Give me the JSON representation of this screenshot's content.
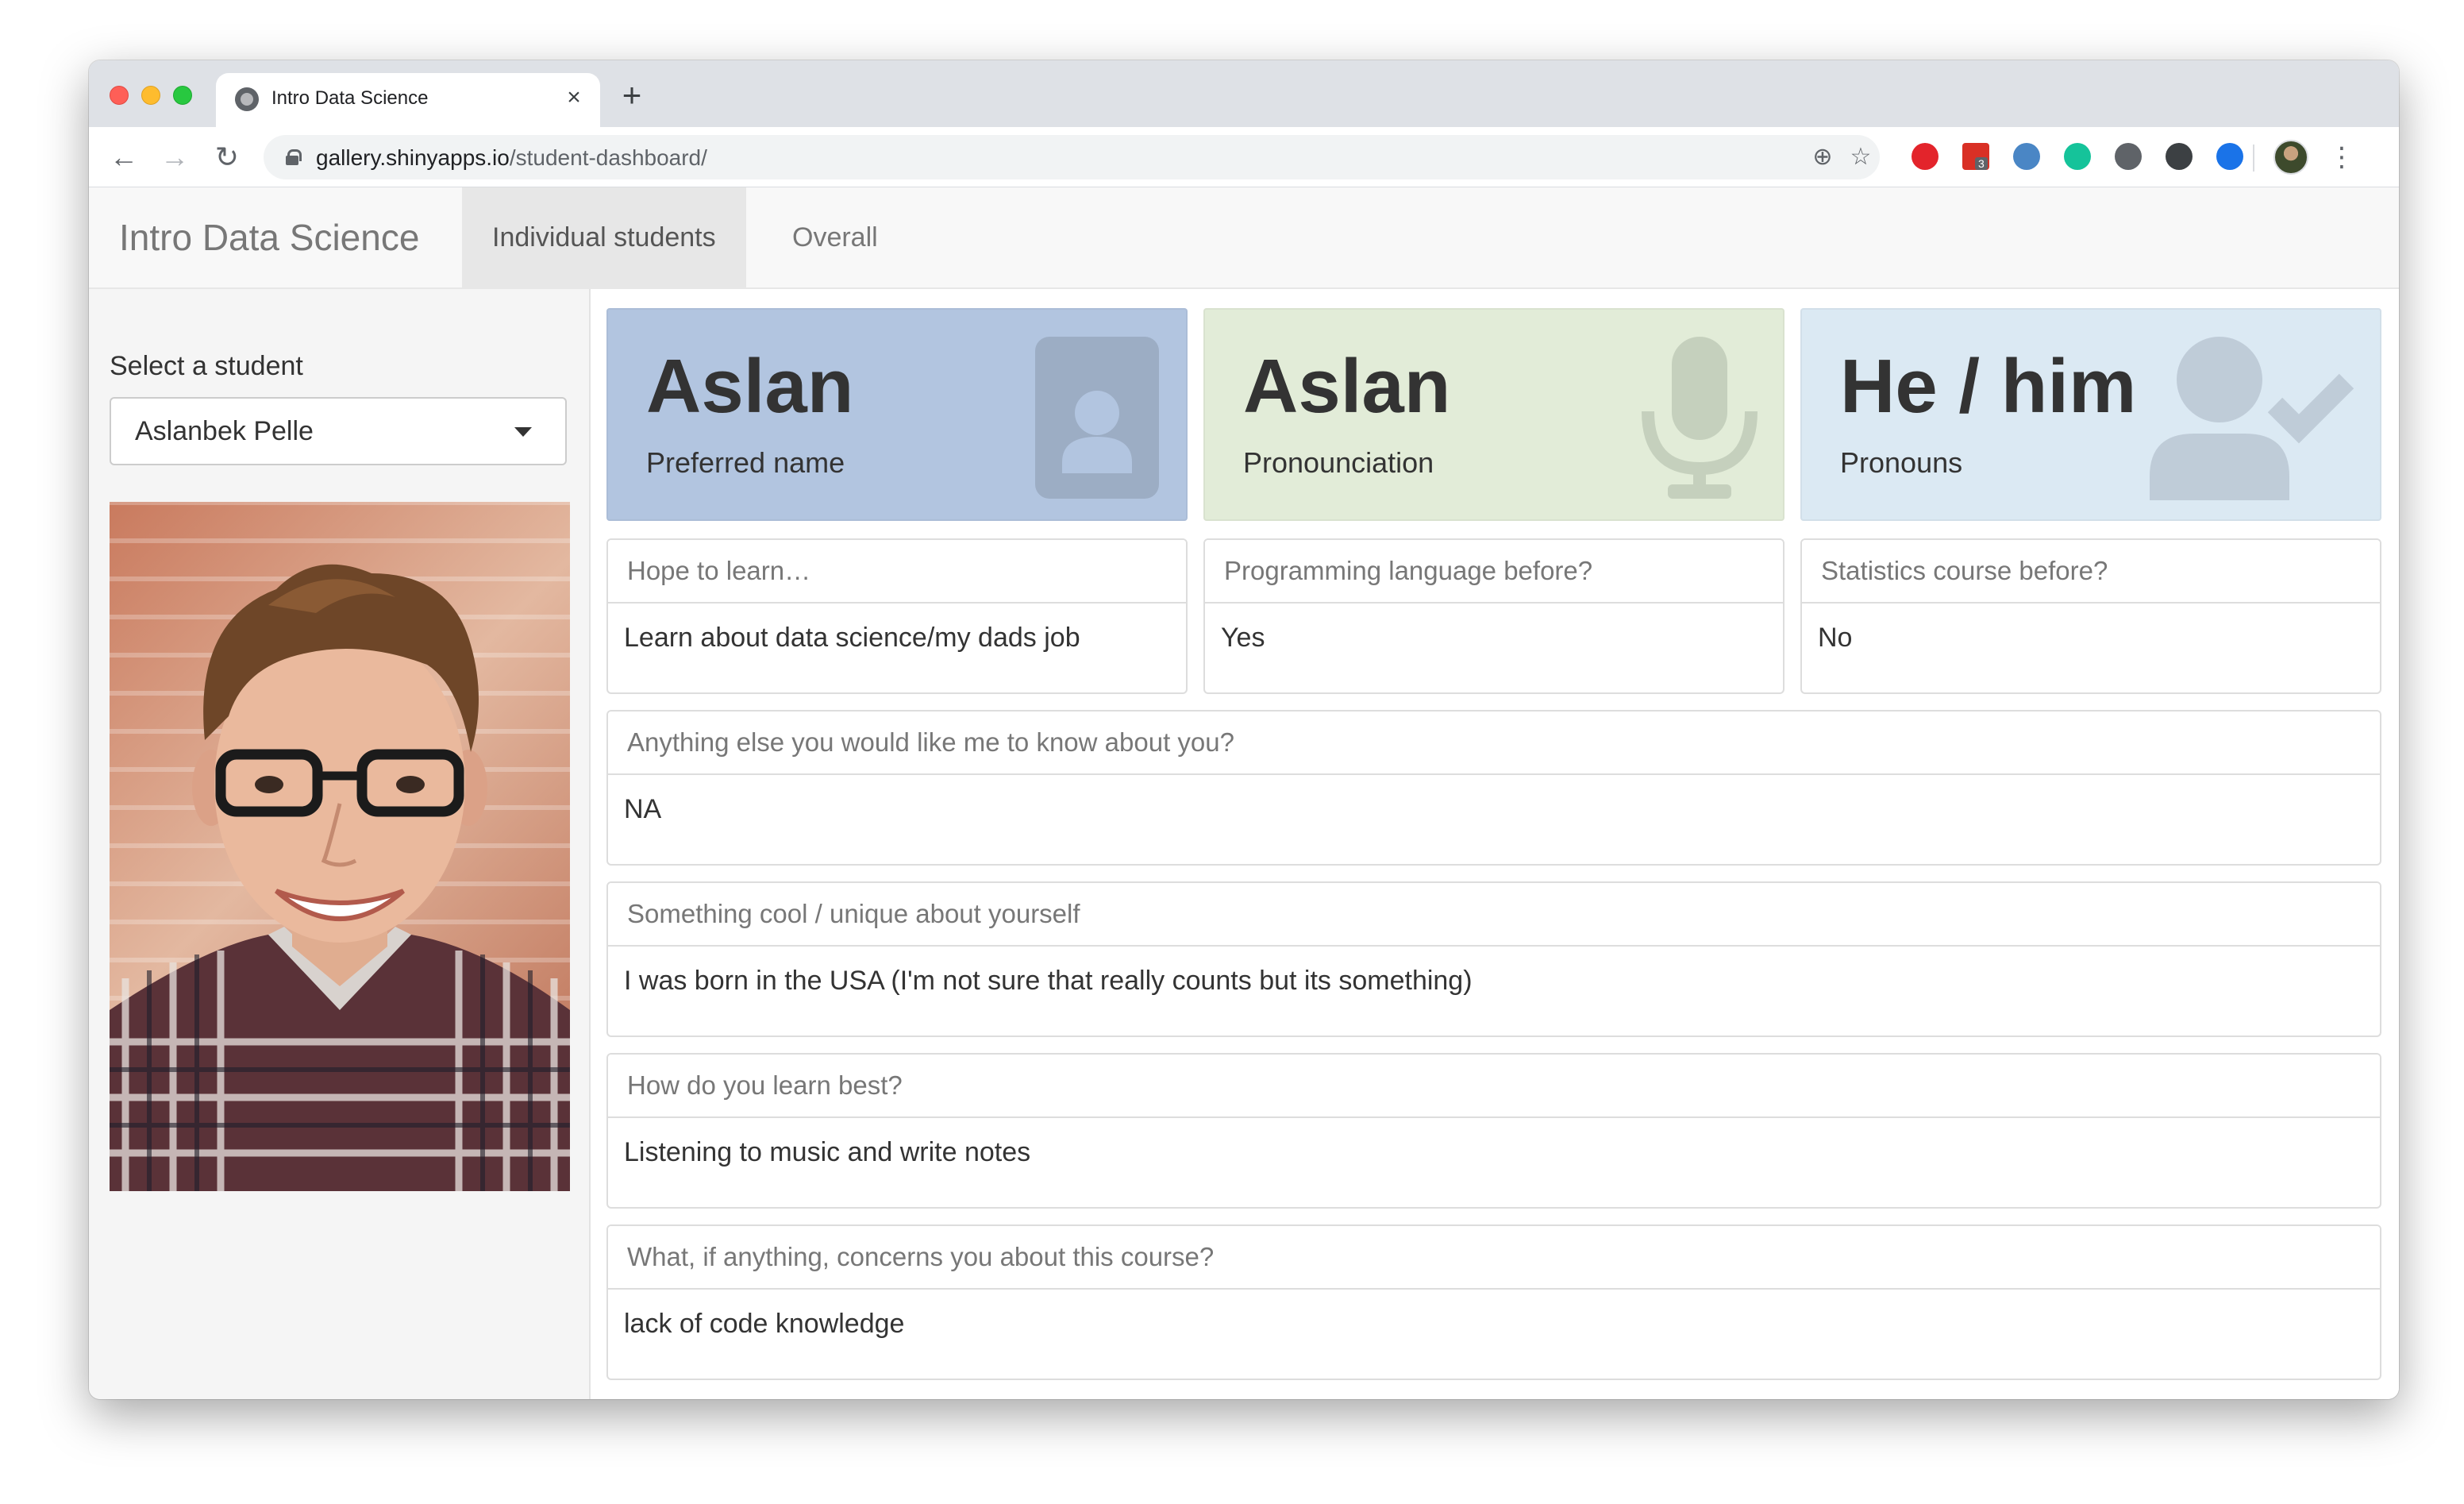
{
  "browser": {
    "tab_title": "Intro Data Science",
    "tab_close": "×",
    "new_tab": "+",
    "url_host": "gallery.shinyapps.io",
    "url_path": "/student-dashboard/",
    "back": "←",
    "forward": "→",
    "reload": "↻",
    "zoom": "⊕",
    "star": "☆",
    "menu": "⋮",
    "extension_badge": "3",
    "extensions": [
      {
        "name": "adblock-icon",
        "color": "#e3242b"
      },
      {
        "name": "calendar-ext-icon",
        "color": "#d93025"
      },
      {
        "name": "satellite-ext-icon",
        "color": "#4a86c5"
      },
      {
        "name": "grammarly-icon",
        "color": "#15c39a"
      },
      {
        "name": "circle-ext-icon",
        "color": "#5f6368"
      },
      {
        "name": "bulb-ext-icon",
        "color": "#3c4043"
      },
      {
        "name": "triangle-ext-icon",
        "color": "#1a73e8"
      }
    ]
  },
  "navbar": {
    "brand": "Intro Data Science",
    "tabs": [
      {
        "label": "Individual students",
        "active": true
      },
      {
        "label": "Overall",
        "active": false
      }
    ]
  },
  "sidebar": {
    "select_label": "Select a student",
    "selected_student": "Aslanbek Pelle"
  },
  "value_boxes": [
    {
      "value": "Aslan",
      "label": "Preferred name",
      "icon": "id-badge-icon",
      "color": "#b2c5e0"
    },
    {
      "value": "Aslan",
      "label": "Pronounciation",
      "icon": "microphone-icon",
      "color": "#e2ecd8"
    },
    {
      "value": "He / him",
      "label": "Pronouns",
      "icon": "user-check-icon",
      "color": "#dbe9f3"
    }
  ],
  "panels": [
    {
      "heading": "Hope to learn…",
      "body": "Learn about data science/my dads job"
    },
    {
      "heading": "Programming language before?",
      "body": "Yes"
    },
    {
      "heading": "Statistics course before?",
      "body": "No"
    },
    {
      "heading": "Anything else you would like me to know about you?",
      "body": "NA"
    },
    {
      "heading": "Something cool / unique about yourself",
      "body": "I was born in the USA (I'm not sure that really counts but its something)"
    },
    {
      "heading": "How do you learn best?",
      "body": "Listening to music and write notes"
    },
    {
      "heading": "What, if anything, concerns you about this course?",
      "body": "lack of code knowledge"
    }
  ]
}
